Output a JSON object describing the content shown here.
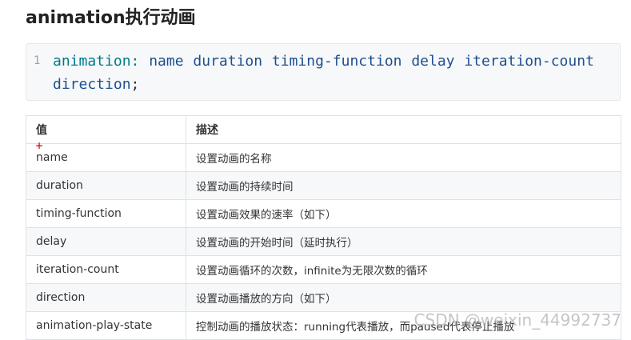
{
  "heading": "animation执行动画",
  "code": {
    "line_number": "1",
    "property": "animation:",
    "values": "name duration timing-function delay iteration-count direction",
    "terminator": ";"
  },
  "table": {
    "headers": [
      "值",
      "描述"
    ],
    "rows": [
      {
        "value": "name",
        "desc": "设置动画的名称"
      },
      {
        "value": "duration",
        "desc": "设置动画的持续时间"
      },
      {
        "value": "timing-function",
        "desc": "设置动画效果的速率（如下）"
      },
      {
        "value": "delay",
        "desc": "设置动画的开始时间（延时执行）"
      },
      {
        "value": "iteration-count",
        "desc": "设置动画循环的次数，infinite为无限次数的循环"
      },
      {
        "value": "direction",
        "desc": "设置动画播放的方向（如下）"
      },
      {
        "value": "animation-play-state",
        "desc": "控制动画的播放状态：running代表播放，而paused代表停止播放"
      }
    ]
  },
  "marker": "+",
  "watermark": "CSDN @weixin_44992737"
}
